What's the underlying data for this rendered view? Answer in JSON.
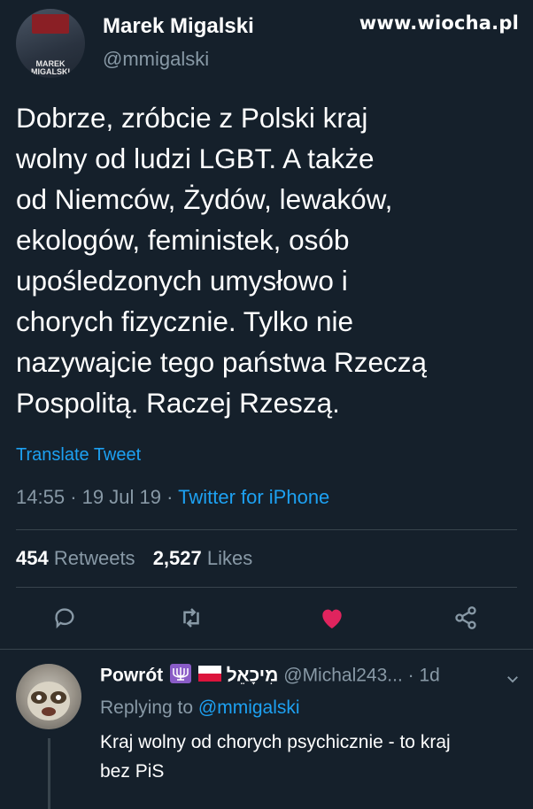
{
  "watermark": "www.wiocha.pl",
  "tweet": {
    "author": {
      "name": "Marek Migalski",
      "handle": "@mmigalski",
      "avatar_text": "MAREK MIGALSKI"
    },
    "text": "Dobrze, zróbcie z Polski kraj\nwolny od ludzi LGBT. A także\nod Niemców, Żydów, lewaków,\nekologów, feministek, osób\nupośledzonych umysłowo i\nchorych fizycznie. Tylko nie\nnazywajcie tego państwa Rzeczą\nPospolitą. Raczej Rzeszą.",
    "translate_label": "Translate Tweet",
    "time": "14:55",
    "date": "19 Jul 19",
    "source": "Twitter for iPhone",
    "retweets_count": "454",
    "retweets_label": "Retweets",
    "likes_count": "2,527",
    "likes_label": "Likes",
    "liked": true
  },
  "actions": {
    "reply_icon": "reply-icon",
    "retweet_icon": "retweet-icon",
    "like_icon": "heart-icon",
    "share_icon": "share-icon"
  },
  "reply": {
    "name": "Powrót",
    "name_suffix": "מִיכָאֵל",
    "handle": "@Michal243...",
    "time": "· 1d",
    "replying_prefix": "Replying to",
    "replying_handle": "@mmigalski",
    "text": "Kraj wolny od chorych psychicznie - to kraj\nbez PiS"
  },
  "colors": {
    "background": "#15202b",
    "accent": "#1da1f2",
    "muted": "#8899a6",
    "like": "#e0245e"
  }
}
